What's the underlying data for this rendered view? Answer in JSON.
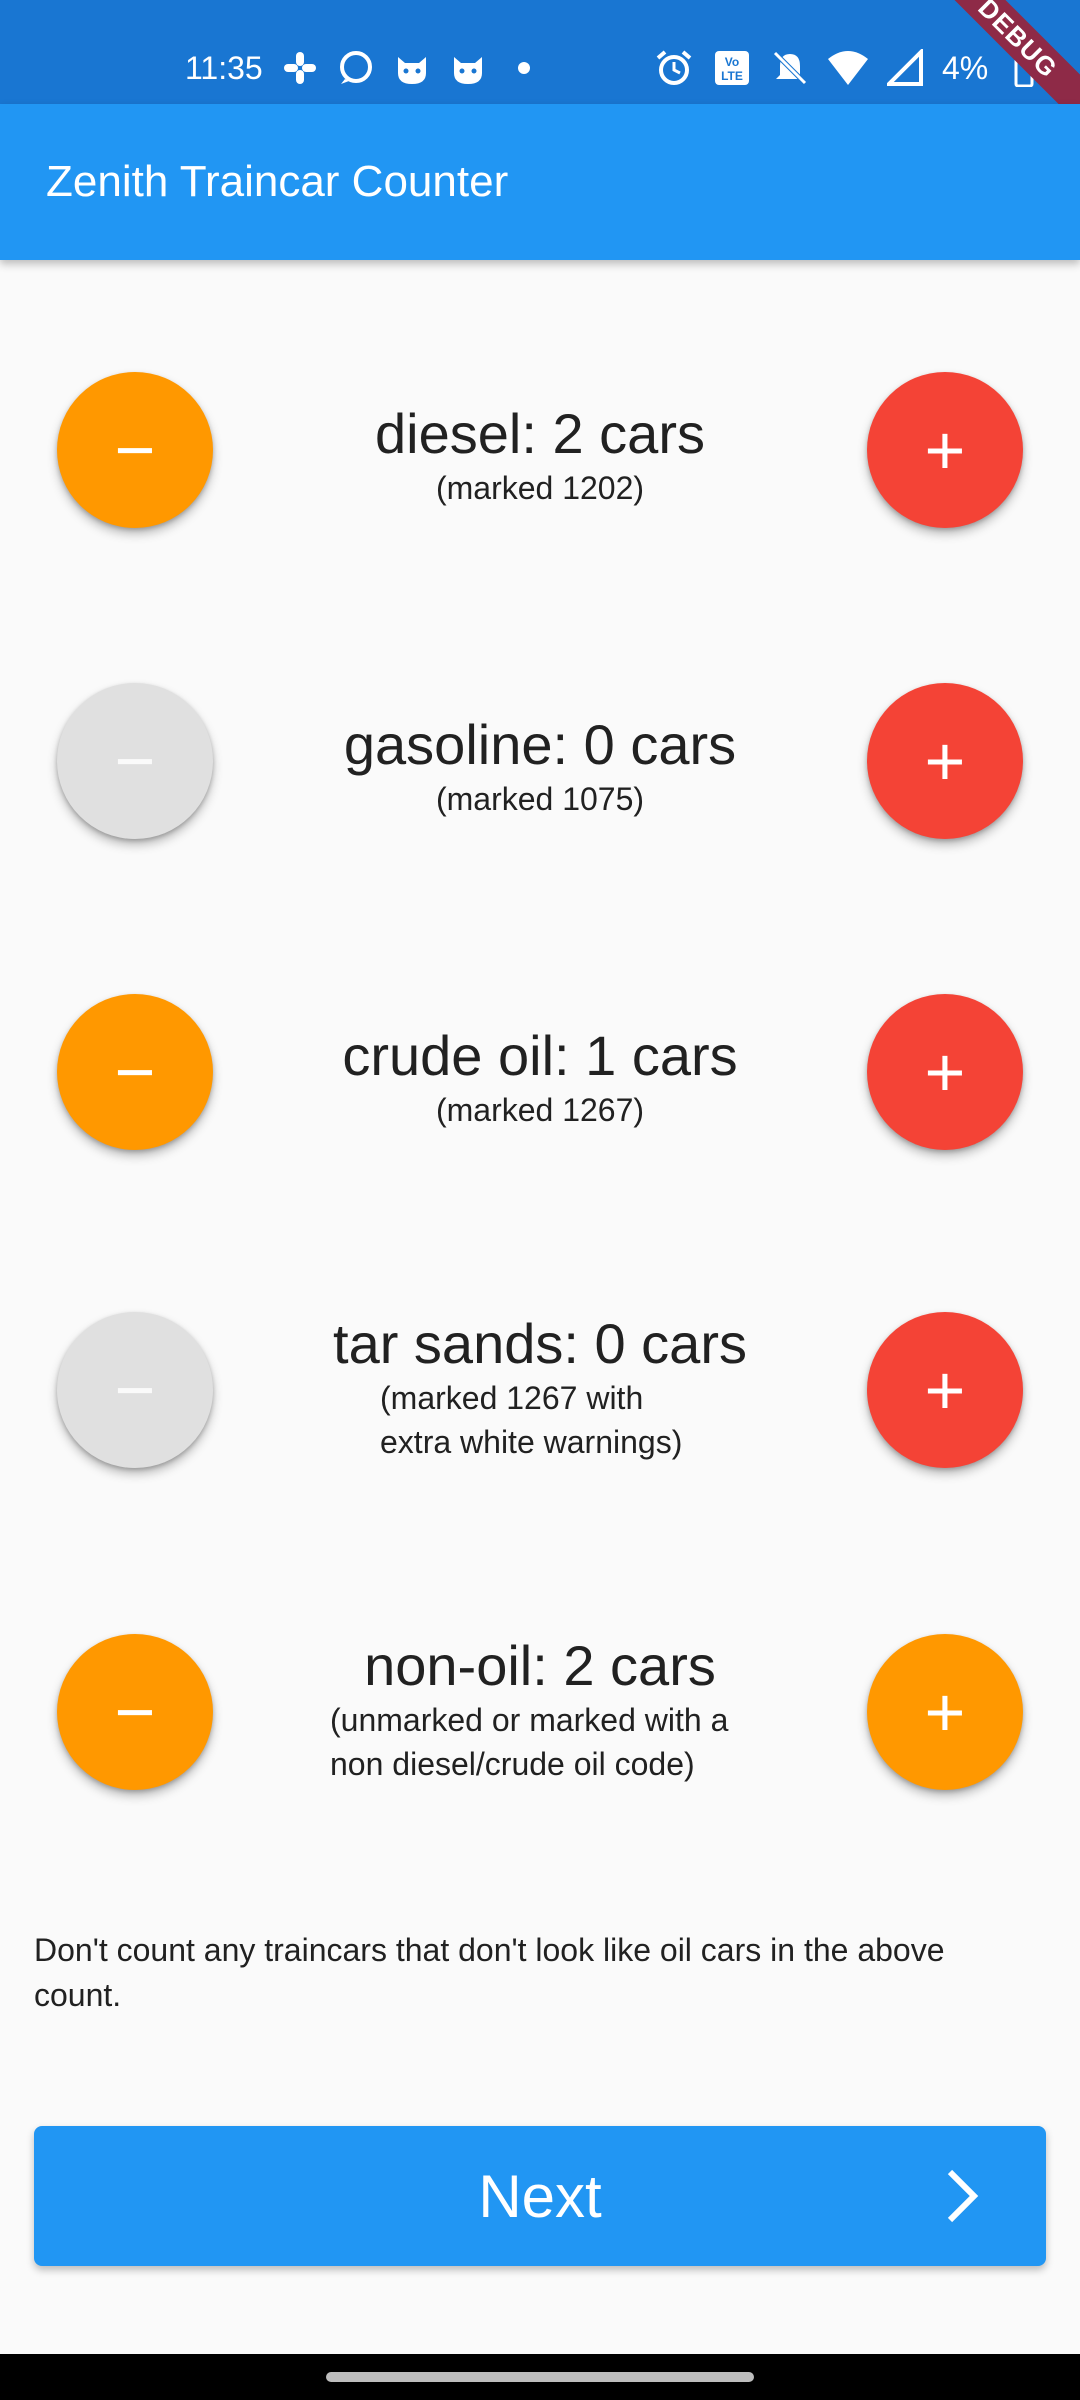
{
  "status_bar": {
    "time": "11:35",
    "battery_percent": "4%",
    "left_icons": [
      "slack-icon",
      "signal-icon",
      "cat-icon",
      "cat-icon",
      "dot-icon"
    ],
    "right_icons": [
      "alarm-icon",
      "volte-icon",
      "bell-off-icon",
      "wifi-icon",
      "cellular-icon"
    ]
  },
  "debug_banner": "DEBUG",
  "app_bar": {
    "title": "Zenith Traincar Counter"
  },
  "counters": [
    {
      "count_text": "diesel: 2 cars",
      "note": "(marked 1202)",
      "minus_state": "enabled",
      "plus_color": "#f44336"
    },
    {
      "count_text": "gasoline: 0 cars",
      "note": "(marked 1075)",
      "minus_state": "disabled",
      "plus_color": "#f44336"
    },
    {
      "count_text": "crude oil: 1 cars",
      "note": "(marked 1267)",
      "minus_state": "enabled",
      "plus_color": "#f44336"
    },
    {
      "count_text": "tar sands: 0 cars",
      "note": "(marked 1267 with extra white warnings)",
      "minus_state": "disabled",
      "plus_color": "#f44336"
    },
    {
      "count_text": "non-oil: 2 cars",
      "note": "(unmarked or marked with a non diesel/crude oil code)",
      "minus_state": "enabled",
      "plus_color": "#ff9800"
    }
  ],
  "buttons": {
    "minus_glyph": "−",
    "plus_glyph": "+"
  },
  "footer_note": "Don't count any traincars that don't look like oil cars in the above count.",
  "next_button": {
    "label": "Next",
    "icon": "chevron-right-icon"
  },
  "colors": {
    "status_bar": "#1976d2",
    "app_bar": "#2196f3",
    "minus_enabled": "#ff9800",
    "minus_disabled": "#e0e0e0",
    "plus_red": "#f44336",
    "plus_orange": "#ff9800"
  }
}
